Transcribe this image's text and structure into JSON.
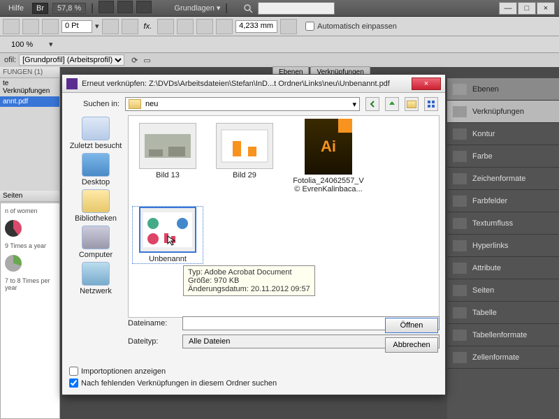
{
  "topbar": {
    "help": "Hilfe",
    "channel": "Br",
    "zoom": "57,8 %",
    "layout_label": "Grundlagen",
    "search_placeholder": ""
  },
  "ctrlbar": {
    "ptvalue": "0 Pt",
    "pctvalue": "100 %",
    "mmvalue": "4,233 mm",
    "autofit": "Automatisch einpassen"
  },
  "profile": {
    "label": "ofil:",
    "value": "[Grundprofil] (Arbeitsprofil)"
  },
  "left": {
    "panel_title": "FUNGEN (1)",
    "subtitle": "te Verknüpfungen",
    "item1": "annt.pdf",
    "seiten": "Seiten"
  },
  "canvas_labels": {
    "a": "n of women",
    "b": "9 Times a year",
    "c": "7 to 8 Times per year"
  },
  "tabs": {
    "t1": "Ebenen",
    "t2": "Verknüpfungen"
  },
  "panels": [
    "Ebenen",
    "Verknüpfungen",
    "Kontur",
    "Farbe",
    "Zeichenformate",
    "Farbfelder",
    "Textumfluss",
    "Hyperlinks",
    "Attribute",
    "Seiten",
    "Tabelle",
    "Tabellenformate",
    "Zellenformate"
  ],
  "dialog": {
    "title": "Erneut verknüpfen: Z:\\DVDs\\Arbeitsdateien\\Stefan\\InD...t Ordner\\Links\\neu\\Unbenannt.pdf",
    "search_in": "Suchen in:",
    "folder": "neu",
    "places": {
      "recent": "Zuletzt besucht",
      "desktop": "Desktop",
      "libraries": "Bibliotheken",
      "computer": "Computer",
      "network": "Netzwerk"
    },
    "files": {
      "f1": "Bild 13",
      "f2": "Bild 29",
      "f3a": "Fotolia_24062557_V",
      "f3b": "© EvrenKalinbaca...",
      "f4": "Unbenannt"
    },
    "tooltip": {
      "l1": "Typ: Adobe Acrobat Document",
      "l2": "Größe: 970 KB",
      "l3": "Änderungsdatum: 20.11.2012 09:57"
    },
    "filename_label": "Dateiname:",
    "filetype_label": "Dateityp:",
    "filename_value": "",
    "filetype_value": "Alle Dateien",
    "open": "Öffnen",
    "cancel": "Abbrechen",
    "chk1": "Importoptionen anzeigen",
    "chk2": "Nach fehlenden Verknüpfungen in diesem Ordner suchen"
  }
}
